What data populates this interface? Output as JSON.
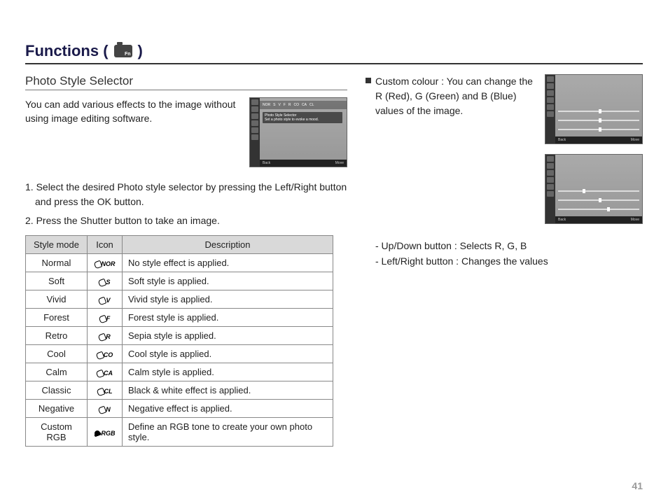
{
  "page": {
    "title_prefix": "Functions (",
    "title_suffix": ")",
    "camera_fn": "Fn",
    "page_number": "41"
  },
  "left": {
    "subtitle": "Photo Style Selector",
    "intro": "You can add various effects to the image without using image editing software.",
    "thumb": {
      "tooltip_title": "Photo Style Selector",
      "tooltip_desc": "Set a photo style to evoke a mood.",
      "status_left": "Back",
      "status_right": "Move",
      "strip_icons": [
        "NOR",
        "S",
        "V",
        "F",
        "R",
        "CO",
        "CA",
        "CL"
      ]
    },
    "steps": [
      "1. Select the desired Photo style selector by pressing the Left/Right button and press the OK button.",
      "2. Press the Shutter button to take an image."
    ],
    "table": {
      "headers": [
        "Style mode",
        "Icon",
        "Description"
      ],
      "rows": [
        {
          "mode": "Normal",
          "icon": "NOR",
          "desc": "No style effect is applied."
        },
        {
          "mode": "Soft",
          "icon": "S",
          "desc": "Soft style is applied."
        },
        {
          "mode": "Vivid",
          "icon": "V",
          "desc": "Vivid style is applied."
        },
        {
          "mode": "Forest",
          "icon": "F",
          "desc": "Forest style is applied."
        },
        {
          "mode": "Retro",
          "icon": "R",
          "desc": "Sepia style is applied."
        },
        {
          "mode": "Cool",
          "icon": "CO",
          "desc": "Cool style is applied."
        },
        {
          "mode": "Calm",
          "icon": "CA",
          "desc": "Calm style is applied."
        },
        {
          "mode": "Classic",
          "icon": "CL",
          "desc": "Black & white effect is applied."
        },
        {
          "mode": "Negative",
          "icon": "N",
          "desc": "Negative effect is applied."
        },
        {
          "mode": "Custom RGB",
          "icon": "RGB",
          "desc": "Define an RGB tone to create your own photo style."
        }
      ]
    }
  },
  "right": {
    "custom_label": "Custom colour :",
    "custom_desc": "You can change the R (Red), G (Green) and B (Blue) values of the image.",
    "sub": [
      "- Up/Down button : Selects R, G, B",
      "- Left/Right button : Changes the values"
    ],
    "thumb_status_left": "Back",
    "thumb_status_right": "Move"
  }
}
